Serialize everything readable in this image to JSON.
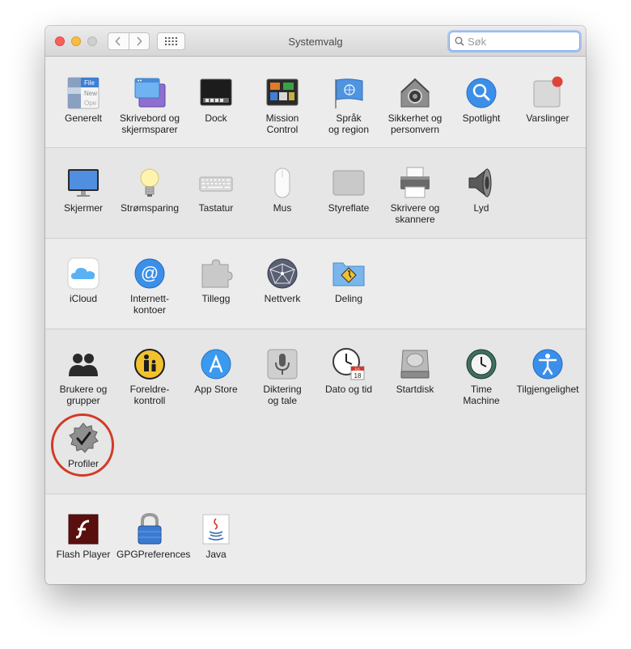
{
  "window": {
    "title": "Systemvalg"
  },
  "search": {
    "placeholder": "Søk",
    "value": ""
  },
  "sections": [
    {
      "items": [
        {
          "label": "Generelt",
          "icon": "general-icon"
        },
        {
          "label": "Skrivebord og\nskjermsparer",
          "icon": "desktop-screensaver-icon"
        },
        {
          "label": "Dock",
          "icon": "dock-icon"
        },
        {
          "label": "Mission\nControl",
          "icon": "mission-control-icon"
        },
        {
          "label": "Språk\nog region",
          "icon": "language-region-icon"
        },
        {
          "label": "Sikkerhet og\npersonvern",
          "icon": "security-privacy-icon"
        },
        {
          "label": "Spotlight",
          "icon": "spotlight-icon"
        },
        {
          "label": "Varslinger",
          "icon": "notifications-icon"
        }
      ]
    },
    {
      "items": [
        {
          "label": "Skjermer",
          "icon": "displays-icon"
        },
        {
          "label": "Strømsparing",
          "icon": "energy-saver-icon"
        },
        {
          "label": "Tastatur",
          "icon": "keyboard-icon"
        },
        {
          "label": "Mus",
          "icon": "mouse-icon"
        },
        {
          "label": "Styreflate",
          "icon": "trackpad-icon"
        },
        {
          "label": "Skrivere og\nskannere",
          "icon": "printers-scanners-icon"
        },
        {
          "label": "Lyd",
          "icon": "sound-icon"
        }
      ]
    },
    {
      "items": [
        {
          "label": "iCloud",
          "icon": "icloud-icon"
        },
        {
          "label": "Internett-\nkontoer",
          "icon": "internet-accounts-icon"
        },
        {
          "label": "Tillegg",
          "icon": "extensions-icon"
        },
        {
          "label": "Nettverk",
          "icon": "network-icon"
        },
        {
          "label": "Deling",
          "icon": "sharing-icon"
        }
      ]
    },
    {
      "items": [
        {
          "label": "Brukere og\ngrupper",
          "icon": "users-groups-icon"
        },
        {
          "label": "Foreldre-\nkontroll",
          "icon": "parental-controls-icon"
        },
        {
          "label": "App Store",
          "icon": "app-store-icon"
        },
        {
          "label": "Diktering\nog tale",
          "icon": "dictation-speech-icon"
        },
        {
          "label": "Dato og tid",
          "icon": "date-time-icon",
          "calendar_month": "JUL",
          "calendar_day": "18"
        },
        {
          "label": "Startdisk",
          "icon": "startup-disk-icon"
        },
        {
          "label": "Time\nMachine",
          "icon": "time-machine-icon"
        },
        {
          "label": "Tilgjengelighet",
          "icon": "accessibility-icon"
        },
        {
          "label": "Profiler",
          "icon": "profiles-icon",
          "highlighted": true
        }
      ]
    },
    {
      "items": [
        {
          "label": "Flash Player",
          "icon": "flash-player-icon"
        },
        {
          "label": "GPGPreferences",
          "icon": "gpg-preferences-icon"
        },
        {
          "label": "Java",
          "icon": "java-icon"
        }
      ]
    }
  ],
  "colors": {
    "highlight_ring": "#d23a26",
    "search_focus": "#80aef2"
  }
}
